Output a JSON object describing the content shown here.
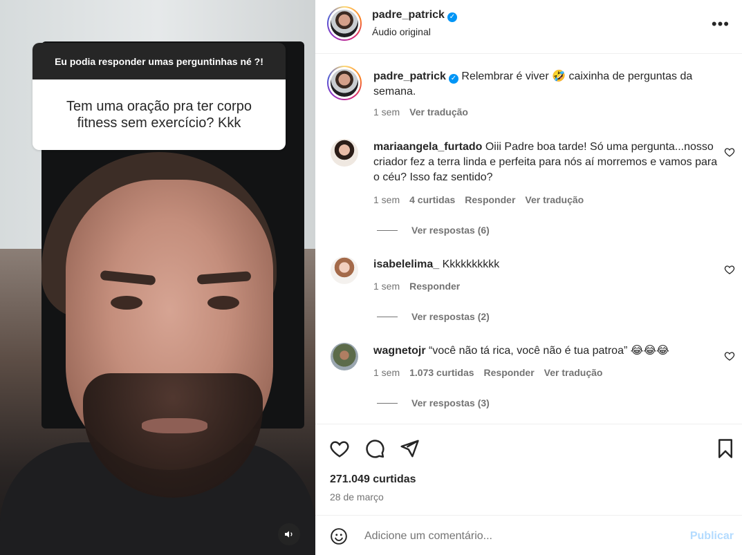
{
  "media": {
    "question_header": "Eu podia responder umas perguntinhas né ?!",
    "question_text": "Tem uma oração pra ter corpo fitness sem exercício? Kkk",
    "sound_icon": "speaker-icon"
  },
  "header": {
    "username": "padre_patrick",
    "verified": "✓",
    "subtitle": "Áudio original",
    "more": "•••"
  },
  "caption": {
    "username": "padre_patrick",
    "verified": "✓",
    "text": "Relembrar é viver 🤣 caixinha de perguntas da semana.",
    "time": "1 sem",
    "translate": "Ver tradução"
  },
  "comments": [
    {
      "username": "mariaangela_furtado",
      "text": "Oiii Padre boa tarde! Só uma pergunta...nosso criador fez a terra linda e perfeita para nós aí morremos e vamos para o céu? Isso faz sentido?",
      "time": "1 sem",
      "likes": "4 curtidas",
      "reply": "Responder",
      "translate": "Ver tradução",
      "view_replies": "Ver respostas (6)"
    },
    {
      "username": "isabelelima_",
      "text": "Kkkkkkkkkk",
      "time": "1 sem",
      "reply": "Responder",
      "view_replies": "Ver respostas (2)"
    },
    {
      "username": "wagnetojr",
      "text": "“você não tá rica, você não é tua patroa” 😂😂😂",
      "time": "1 sem",
      "likes": "1.073 curtidas",
      "reply": "Responder",
      "translate": "Ver tradução",
      "view_replies": "Ver respostas (3)"
    }
  ],
  "actions": {
    "likes": "271.049 curtidas",
    "date": "28 de março"
  },
  "compose": {
    "placeholder": "Adicione um comentário...",
    "publish": "Publicar"
  },
  "colors": {
    "accent": "#0095f6",
    "publish_disabled": "#b3dbff",
    "secondary_text": "#737373",
    "dark_bar": "#262626"
  }
}
